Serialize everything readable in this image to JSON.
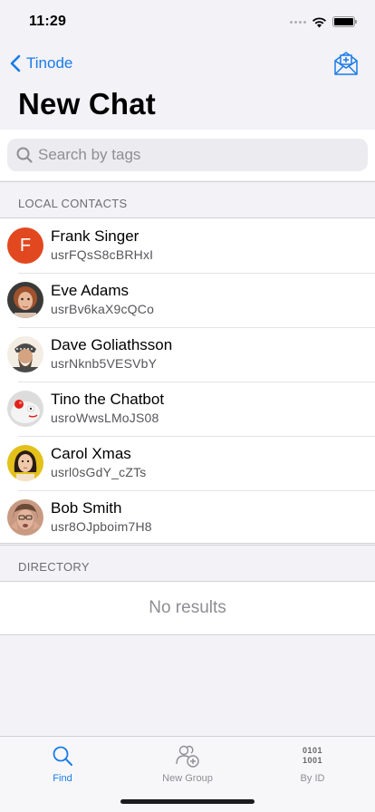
{
  "status_bar": {
    "time": "11:29"
  },
  "nav": {
    "back_label": "Tinode"
  },
  "page": {
    "title": "New Chat"
  },
  "search": {
    "placeholder": "Search by tags",
    "value": ""
  },
  "local_contacts": {
    "header": "LOCAL CONTACTS",
    "items": [
      {
        "name": "Frank Singer",
        "id": "usrFQsS8cBRHxI",
        "avatar": "letter-F"
      },
      {
        "name": "Eve Adams",
        "id": "usrBv6kaX9cQCo",
        "avatar": "photo-eve"
      },
      {
        "name": "Dave Goliathsson",
        "id": "usrNknb5VESVbY",
        "avatar": "photo-dave"
      },
      {
        "name": "Tino the Chatbot",
        "id": "usroWwsLMoJS08",
        "avatar": "photo-tino"
      },
      {
        "name": "Carol Xmas",
        "id": "usrl0sGdY_cZTs",
        "avatar": "photo-carol"
      },
      {
        "name": "Bob Smith",
        "id": "usr8OJpboim7H8",
        "avatar": "photo-bob"
      }
    ],
    "letter_avatar": "F"
  },
  "directory": {
    "header": "DIRECTORY",
    "empty_text": "No results"
  },
  "tabs": [
    {
      "label": "Find",
      "icon": "search-icon",
      "active": true
    },
    {
      "label": "New Group",
      "icon": "add-group-icon",
      "active": false
    },
    {
      "label": "By ID",
      "icon": "binary-id-icon",
      "active": false,
      "icon_text": [
        "0101",
        "1001"
      ]
    }
  ],
  "colors": {
    "accent": "#1a7be8",
    "letter_avatar_bg": "#e2481f"
  }
}
